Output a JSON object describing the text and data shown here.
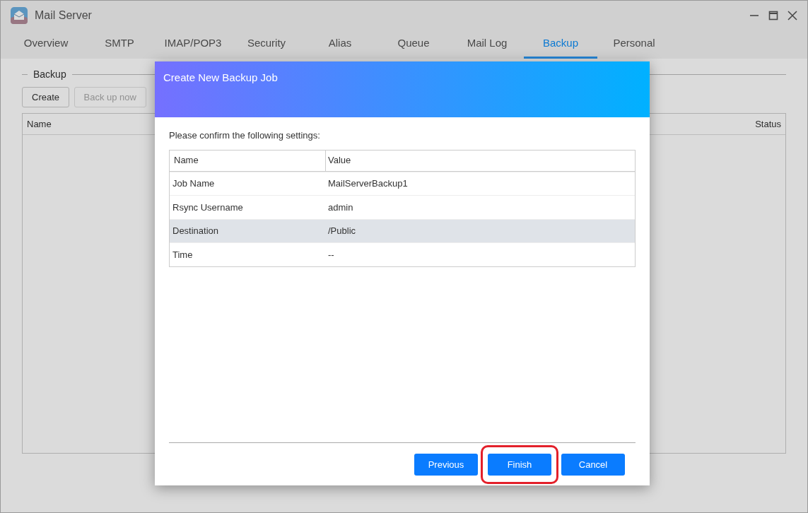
{
  "window": {
    "title": "Mail Server"
  },
  "tabs": [
    {
      "label": "Overview",
      "selected": false
    },
    {
      "label": "SMTP",
      "selected": false
    },
    {
      "label": "IMAP/POP3",
      "selected": false
    },
    {
      "label": "Security",
      "selected": false
    },
    {
      "label": "Alias",
      "selected": false
    },
    {
      "label": "Queue",
      "selected": false
    },
    {
      "label": "Mail Log",
      "selected": false
    },
    {
      "label": "Backup",
      "selected": true
    },
    {
      "label": "Personal",
      "selected": false
    }
  ],
  "section": {
    "title": "Backup",
    "buttons": [
      {
        "label": "Create",
        "disabled": false
      },
      {
        "label": "Back up now",
        "disabled": true
      }
    ],
    "table": {
      "columns": [
        "Name",
        "Status"
      ]
    }
  },
  "dialog": {
    "title": "Create New Backup Job",
    "prompt": "Please confirm the following settings:",
    "table": {
      "columns": [
        "Name",
        "Value"
      ],
      "rows": [
        {
          "name": "Job Name",
          "value": "MailServerBackup1",
          "selected": false
        },
        {
          "name": "Rsync Username",
          "value": "admin",
          "selected": false
        },
        {
          "name": "Destination",
          "value": "/Public",
          "selected": true
        },
        {
          "name": "Time",
          "value": "--",
          "selected": false
        }
      ]
    },
    "buttons": [
      {
        "label": "Previous",
        "highlighted": false
      },
      {
        "label": "Finish",
        "highlighted": true
      },
      {
        "label": "Cancel",
        "highlighted": false
      }
    ]
  }
}
